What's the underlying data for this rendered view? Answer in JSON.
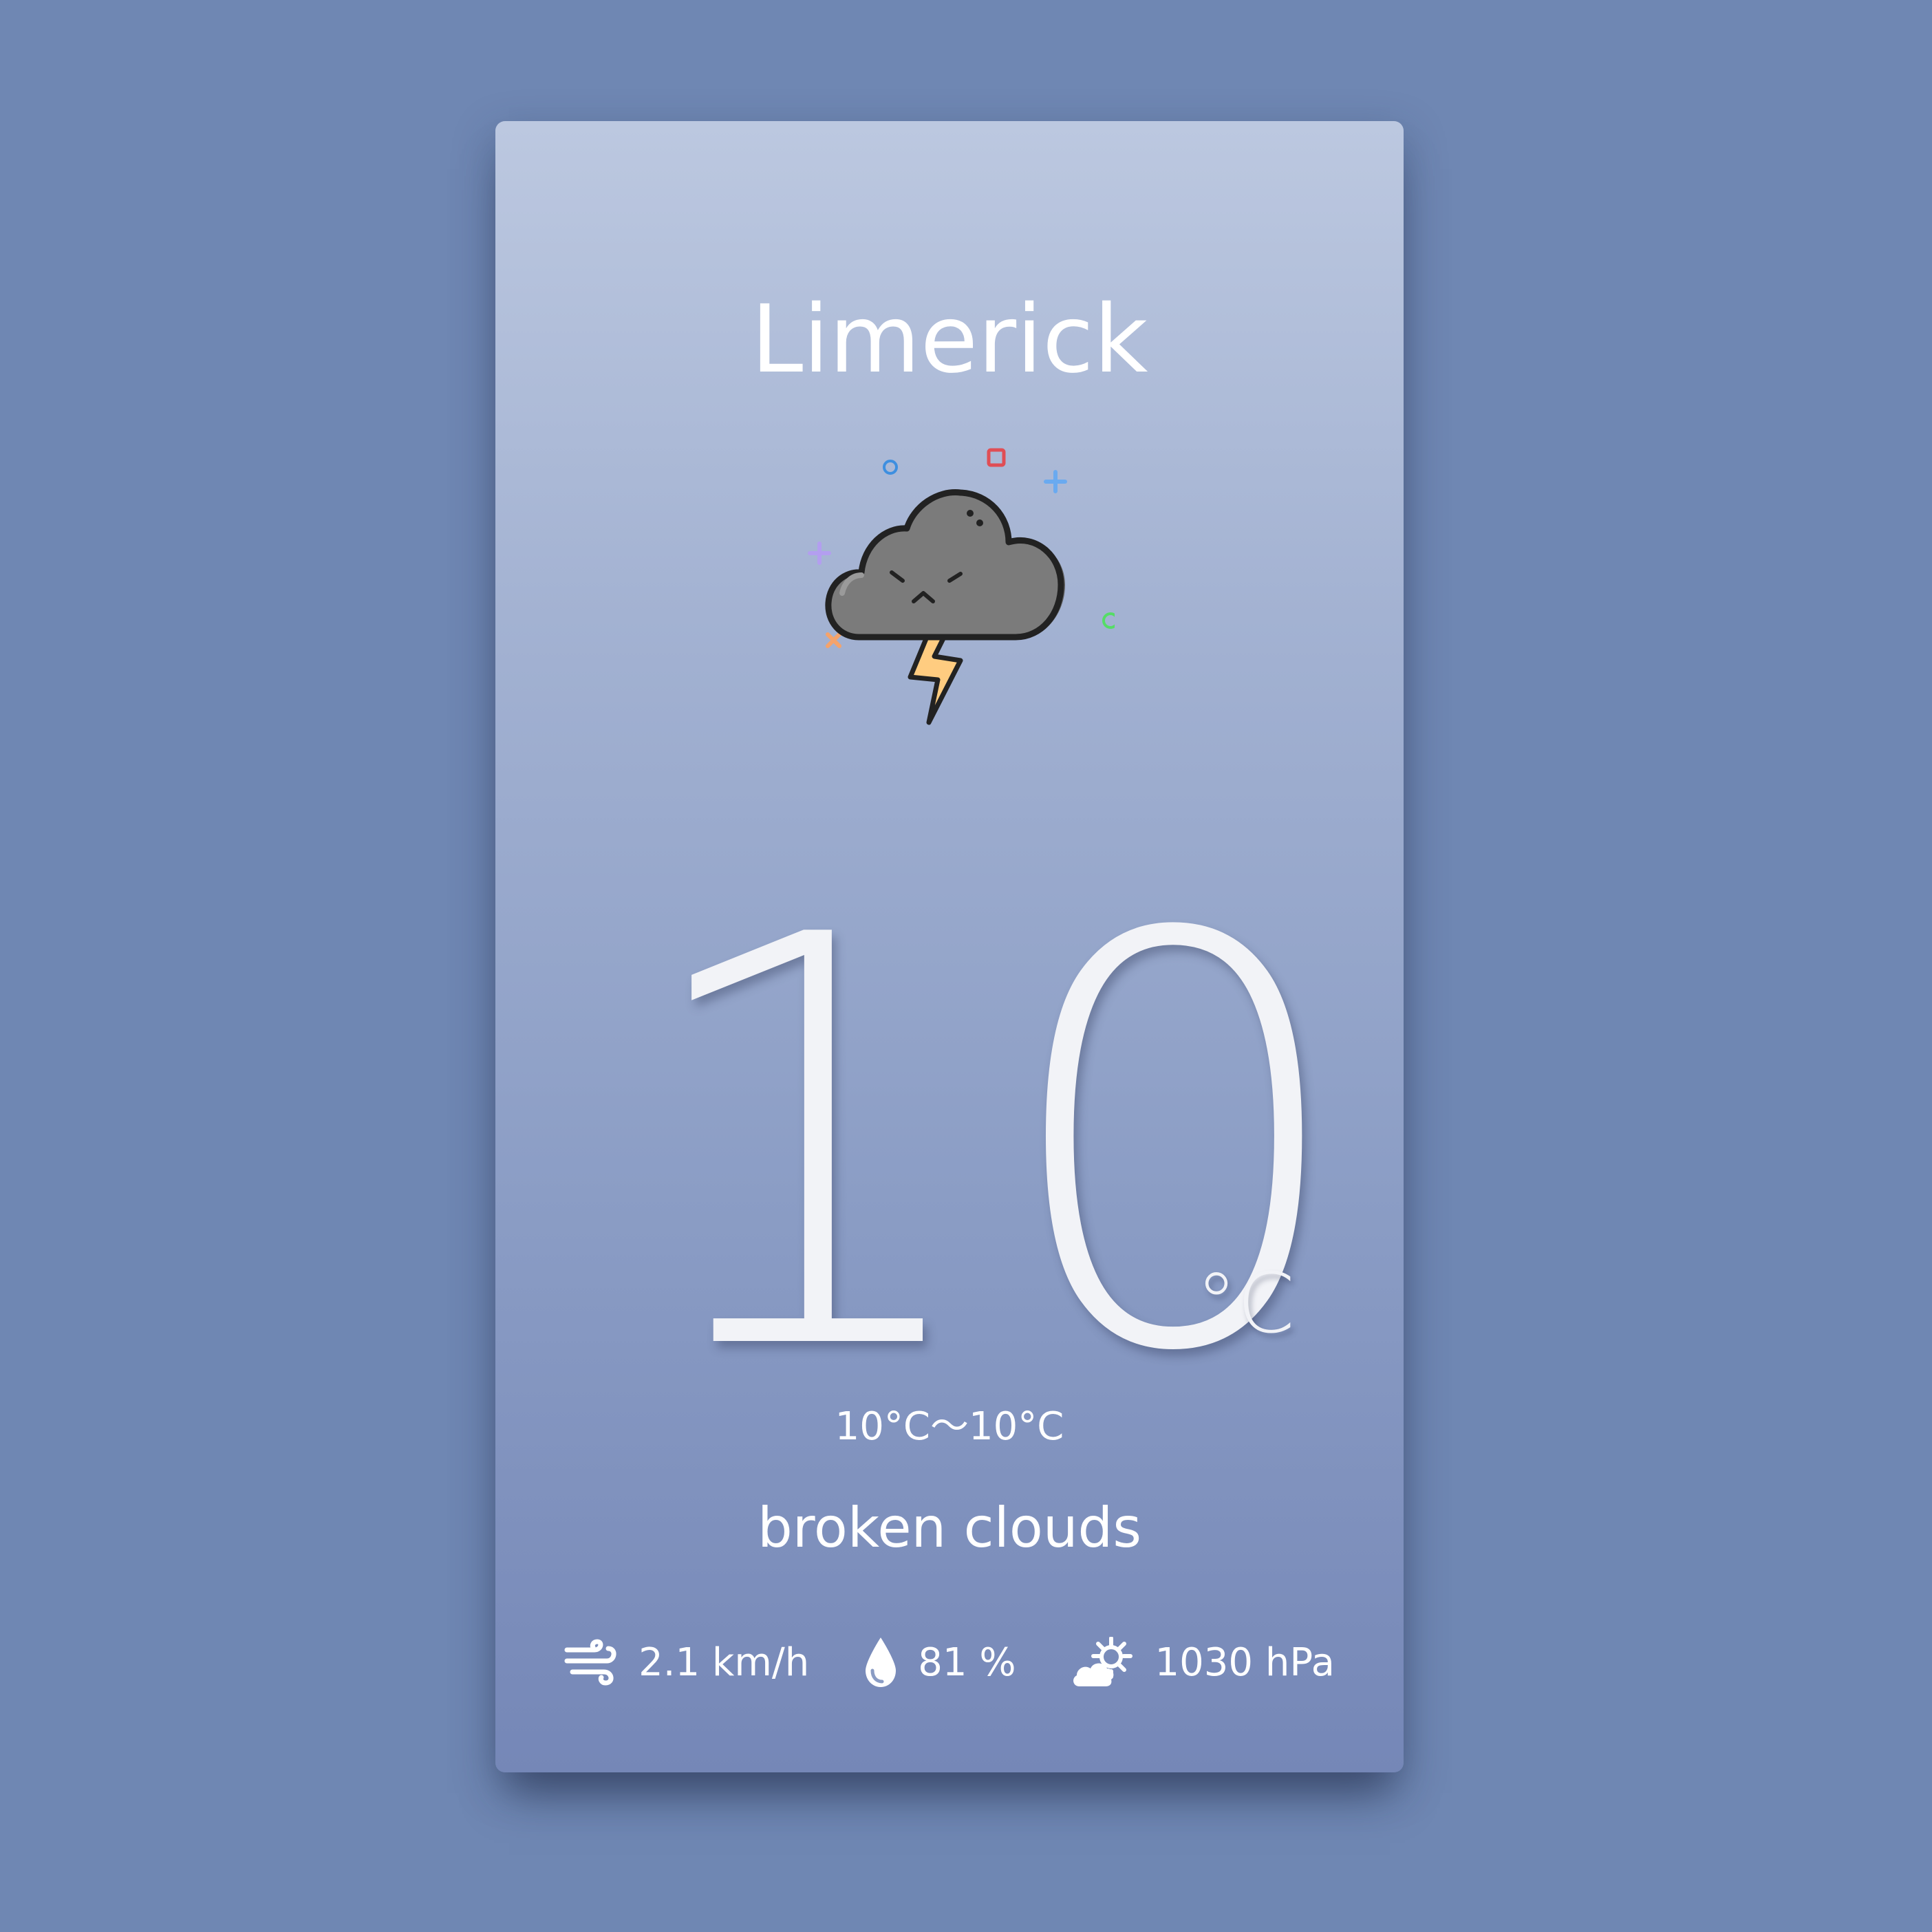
{
  "weather": {
    "city": "Limerick",
    "icon": "thunderstorm-cloud-icon",
    "temperature": "10",
    "unit": "°C",
    "range": "10°C～10°C",
    "description": "broken clouds",
    "stats": {
      "wind": "2.1 km/h",
      "humidity": "81 %",
      "pressure": "1030 hPa"
    }
  },
  "colors": {
    "background": "#6f87b3",
    "card_top": "#bcc8e0",
    "card_bottom": "#7587b7",
    "text": "#ffffff",
    "cloud": "#7a7a7a",
    "lightning": "#ffcc80"
  }
}
